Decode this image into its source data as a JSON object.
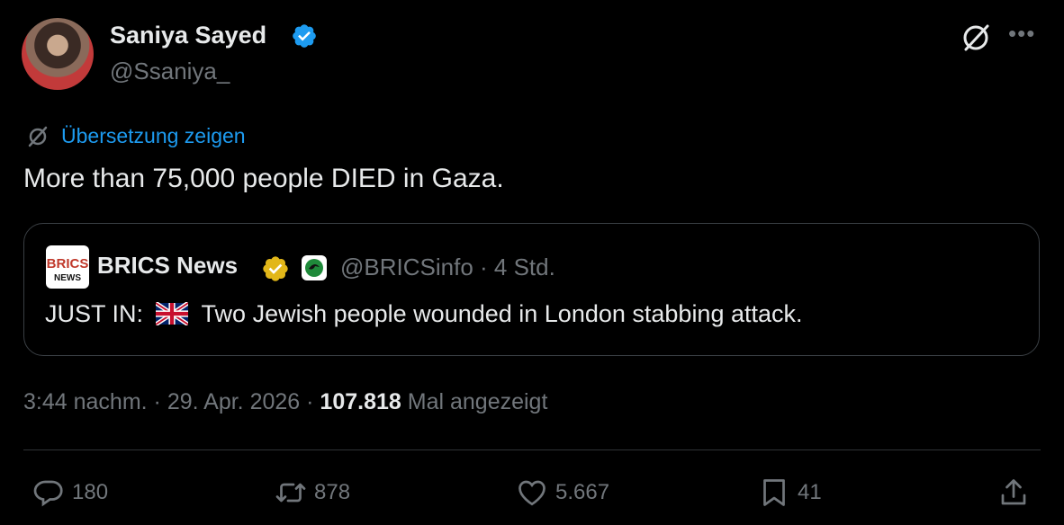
{
  "author": {
    "name": "Saniya Sayed",
    "handle": "@Ssaniya_"
  },
  "translate_label": "Übersetzung zeigen",
  "tweet_text": "More than 75,000 people DIED in Gaza.",
  "quote": {
    "logo_text": "BRICS NEWS",
    "name": "BRICS News",
    "handle": "@BRICSinfo",
    "time": "· 4 Std.",
    "text_prefix": "JUST IN:",
    "text_body": "Two Jewish people wounded in London stabbing attack."
  },
  "meta": {
    "time": "3:44 nachm.",
    "date": "29. Apr. 2026",
    "views": "107.818",
    "views_label": "Mal angezeigt"
  },
  "actions": {
    "replies": "180",
    "reposts": "878",
    "likes": "5.667",
    "bookmarks": "41"
  },
  "colors": {
    "background": "#000000",
    "text": "#e7e9ea",
    "secondary": "#71767b",
    "link": "#1d9bf0",
    "verified": "#1d9bf0",
    "gold": "#e2b719"
  },
  "icons": [
    "verified-badge-icon",
    "grok-icon",
    "more-icon",
    "translate-icon",
    "reply-icon",
    "repost-icon",
    "like-icon",
    "bookmark-icon",
    "share-icon"
  ]
}
